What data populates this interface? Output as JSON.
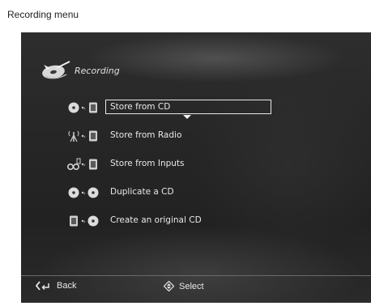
{
  "caption": "Recording menu",
  "header": {
    "title": "Recording",
    "icon": "recording-icon"
  },
  "menu": {
    "items": [
      {
        "label": "Store from CD",
        "icons": [
          "cd-icon",
          "hdd-icon"
        ],
        "selected": true
      },
      {
        "label": "Store from Radio",
        "icons": [
          "radio-icon",
          "hdd-icon"
        ],
        "selected": false
      },
      {
        "label": "Store from Inputs",
        "icons": [
          "inputs-icon",
          "hdd-icon"
        ],
        "selected": false
      },
      {
        "label": "Duplicate a CD",
        "icons": [
          "cd-icon",
          "cd-icon"
        ],
        "selected": false
      },
      {
        "label": "Create an original CD",
        "icons": [
          "hdd-icon",
          "cd-icon"
        ],
        "selected": false
      }
    ]
  },
  "footer": {
    "back_label": "Back",
    "select_label": "Select"
  },
  "colors": {
    "background": "#262626",
    "text": "#e8e8e8",
    "highlight_border": "#e8e8e8"
  }
}
